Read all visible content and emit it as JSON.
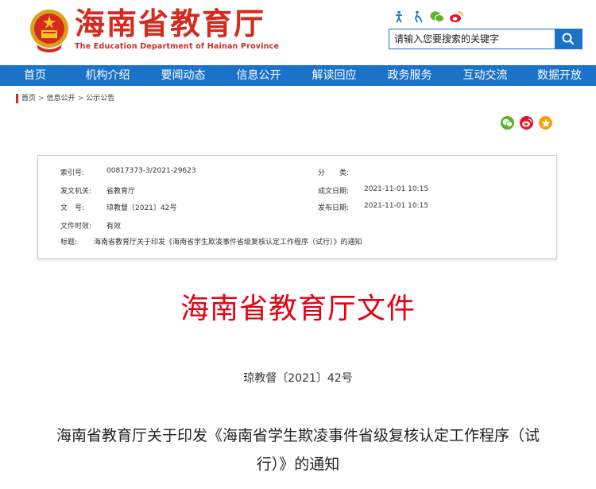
{
  "header": {
    "logo_cn": "海南省教育厅",
    "logo_en": "The Education Department of Hainan Province",
    "tools": [
      "accessibility-icon",
      "elder-care-icon",
      "wechat-icon",
      "weibo-icon"
    ]
  },
  "search": {
    "placeholder": "请输入您要搜索的关键字"
  },
  "nav": {
    "items": [
      {
        "label": "首页"
      },
      {
        "label": "机构介绍"
      },
      {
        "label": "要闻动态"
      },
      {
        "label": "信息公开"
      },
      {
        "label": "解读回应"
      },
      {
        "label": "政务服务"
      },
      {
        "label": "互动交流"
      },
      {
        "label": "数据开放"
      }
    ]
  },
  "breadcrumb": {
    "items": [
      "首页",
      "信息公开",
      "公示公告"
    ],
    "separator": ">"
  },
  "share": {
    "icons": [
      "wechat-share-icon",
      "weibo-share-icon",
      "qzone-share-icon"
    ],
    "colors": {
      "wechat": "#5bb325",
      "weibo": "#e6162d",
      "qzone": "#f4a20c"
    }
  },
  "meta": {
    "index_label": "索引号:",
    "index_value": "00817373-3/2021-29623",
    "category_label": "分　　类:",
    "category_value": "",
    "issuer_label": "发文机关:",
    "issuer_value": "省教育厅",
    "created_label": "成文日期:",
    "created_value": "2021-11-01 10:15",
    "docno_label": "文　号:",
    "docno_value": "琼教督〔2021〕42号",
    "published_label": "发布日期:",
    "published_value": "2021-11-01 10:15",
    "validity_label": "文件时效:",
    "validity_value": "有效",
    "title_label": "标题:",
    "title_value": "海南省教育厅关于印发《海南省学生欺凌事件省级复核认定工作程序（试行）》的通知"
  },
  "document": {
    "red_title": "海南省教育厅文件",
    "doc_number": "琼教督〔2021〕42号",
    "title_line1": "海南省教育厅关于印发《海南省学生欺凌事件省级复核认定工作程序（试",
    "title_line2": "行）》的通知"
  },
  "colors": {
    "brand_red": "#d42b1e",
    "nav_blue": "#1b72c9",
    "title_red": "#e60012"
  }
}
